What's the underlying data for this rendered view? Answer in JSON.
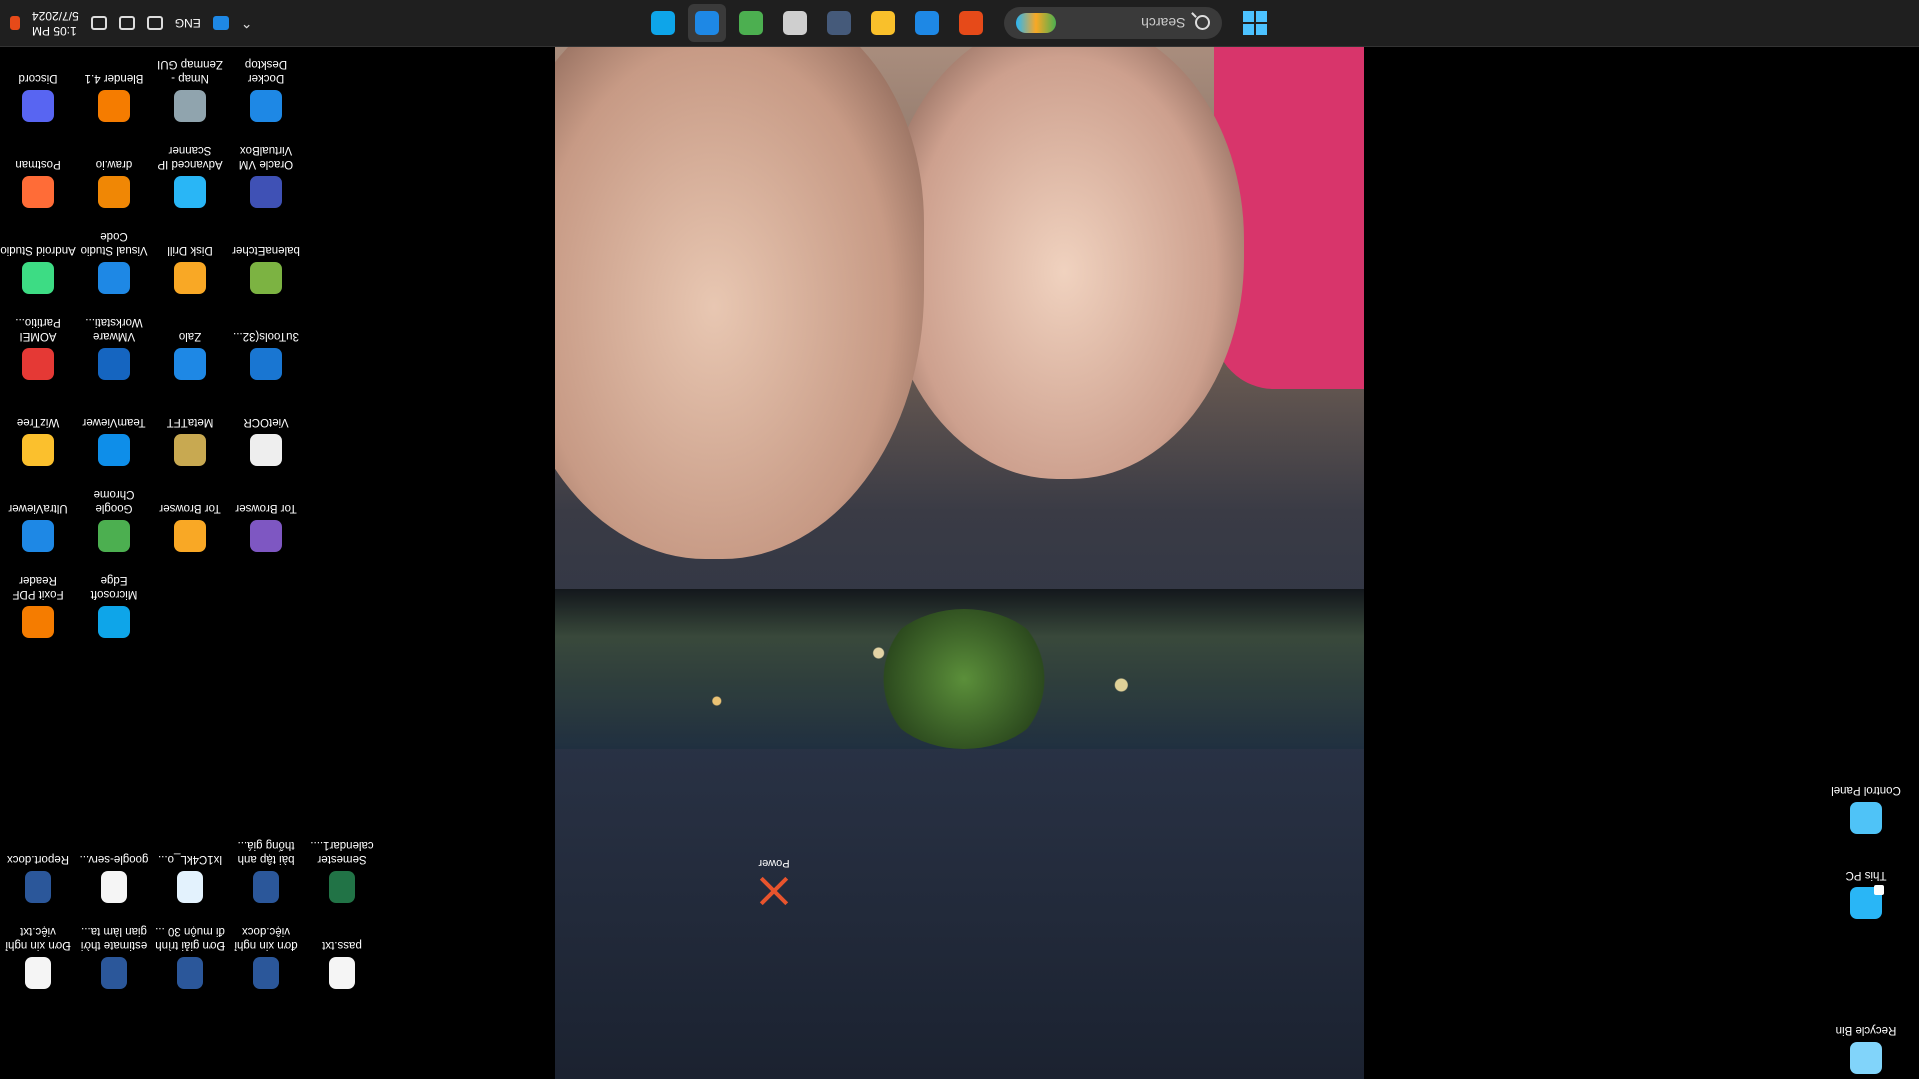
{
  "taskbar": {
    "search_placeholder": "Search",
    "apps": [
      {
        "name": "store-icon",
        "color": "#e64a19"
      },
      {
        "name": "vscode-icon",
        "color": "#1e88e5"
      },
      {
        "name": "file-explorer-icon",
        "color": "#f9c02b"
      },
      {
        "name": "inkscape-icon",
        "color": "#455a7a"
      },
      {
        "name": "steering-app-icon",
        "color": "#cfcfcf"
      },
      {
        "name": "chrome-icon",
        "color": "#4caf50"
      },
      {
        "name": "zalo-icon",
        "color": "#1e88e5"
      },
      {
        "name": "edge-icon",
        "color": "#0ea5e9"
      }
    ],
    "tray": {
      "language": "ENG",
      "time": "1:05 PM",
      "date": "5/7/2024"
    }
  },
  "desktop": {
    "left_icons": [
      {
        "label": "Discord",
        "color": "#5865f2"
      },
      {
        "label": "Blender 4.1",
        "color": "#f57c00"
      },
      {
        "label": "Nmap - Zenmap GUI",
        "color": "#90a4ae"
      },
      {
        "label": "Docker Desktop",
        "color": "#1e88e5"
      },
      {
        "label": "Postman",
        "color": "#ff6c37"
      },
      {
        "label": "draw.io",
        "color": "#f08705"
      },
      {
        "label": "Advanced IP Scanner",
        "color": "#29b6f6"
      },
      {
        "label": "Oracle VM VirtualBox",
        "color": "#3f51b5"
      },
      {
        "label": "Android Studio",
        "color": "#3ddc84"
      },
      {
        "label": "Visual Studio Code",
        "color": "#1e88e5"
      },
      {
        "label": "Disk Drill",
        "color": "#f9a825"
      },
      {
        "label": "balenaEtcher",
        "color": "#7cb342"
      },
      {
        "label": "AOMEI Partitio...",
        "color": "#e53935"
      },
      {
        "label": "VMware Workstati...",
        "color": "#1565c0"
      },
      {
        "label": "Zalo",
        "color": "#1e88e5"
      },
      {
        "label": "3uTools(32...",
        "color": "#1976d2"
      },
      {
        "label": "WizTree",
        "color": "#fbc02d"
      },
      {
        "label": "TeamViewer",
        "color": "#0e8ee9"
      },
      {
        "label": "MetaTFT",
        "color": "#c8a951"
      },
      {
        "label": "VietOCR",
        "color": "#eeeeee"
      },
      {
        "label": "UltraViewer",
        "color": "#1e88e5"
      },
      {
        "label": "Google Chrome",
        "color": "#4caf50"
      },
      {
        "label": "Tor Browser",
        "color": "#f9a825"
      },
      {
        "label": "Tor Browser",
        "color": "#7e57c2"
      },
      {
        "label": "Foxit PDF Reader",
        "color": "#f57c00"
      },
      {
        "label": "Microsoft Edge",
        "color": "#0ea5e9"
      }
    ],
    "bottom_icons": [
      {
        "label": "Report.docx",
        "color": "#2b579a"
      },
      {
        "label": "google-serv...",
        "color": "#f5f5f5"
      },
      {
        "label": "lx1C4kL_o...",
        "color": "#e3f2fd"
      },
      {
        "label": "bài tập anh thống giá...",
        "color": "#2b579a"
      },
      {
        "label": "Semester calendar1....",
        "color": "#217346"
      },
      {
        "label": "Đơn xin nghỉ việc.txt",
        "color": "#f5f5f5"
      },
      {
        "label": "estimate thời gian làm ta...",
        "color": "#2b579a"
      },
      {
        "label": "Đơn giải trình đi muộn 30 ...",
        "color": "#2b579a"
      },
      {
        "label": "đơn xin nghỉ việc.docx",
        "color": "#2b579a"
      },
      {
        "label": "pass.txt",
        "color": "#f5f5f5"
      }
    ],
    "right_icons": [
      {
        "label": "This PC",
        "color": "#29b6f6"
      },
      {
        "label": "Control Panel",
        "color": "#4fc3f7"
      },
      {
        "label": "Recycle Bin",
        "color": "#81d4fa"
      }
    ],
    "wallpaper_icon": {
      "label": "Power"
    }
  }
}
